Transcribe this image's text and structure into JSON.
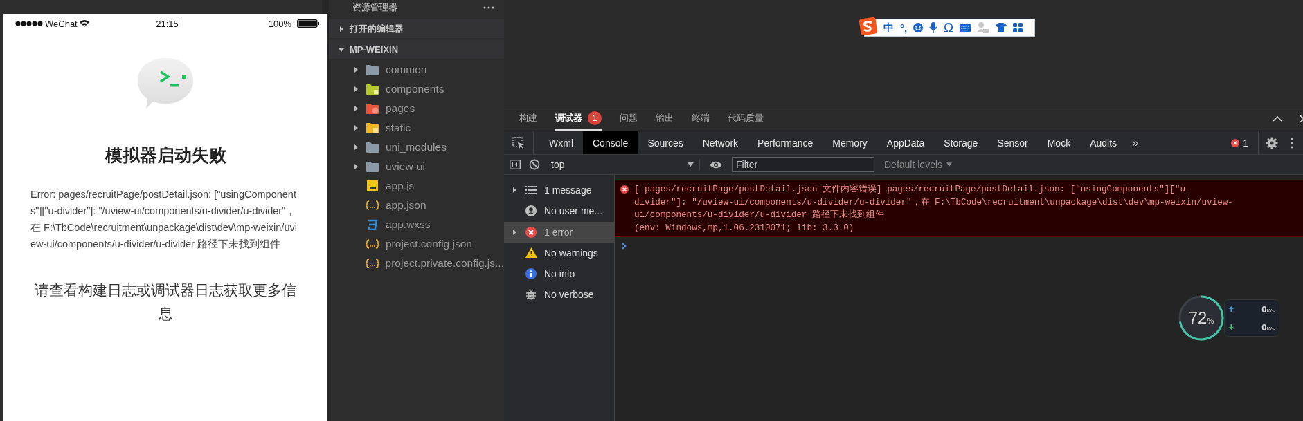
{
  "simulator": {
    "status_bar": {
      "carrier": "WeChat",
      "time": "21:15",
      "battery": "100%"
    },
    "title": "模拟器启动失败",
    "error": "Error: pages/recruitPage/postDetail.json: [\"usingComponents\"][\"u-divider\"]: \"/uview-ui/components/u-divider/u-divider\"，在 F:\\TbCode\\recruitment\\unpackage\\dist\\dev\\mp-weixin/uview-ui/components/u-divider/u-divider 路径下未找到组件",
    "hint": "请查看构建日志或调试器日志获取更多信息"
  },
  "explorer": {
    "title": "资源管理器",
    "sections": [
      {
        "label": "打开的编辑器",
        "expanded": false
      },
      {
        "label": "MP-WEIXIN",
        "expanded": true
      }
    ],
    "files": [
      {
        "name": "common",
        "kind": "folder"
      },
      {
        "name": "components",
        "kind": "components-folder"
      },
      {
        "name": "pages",
        "kind": "pages-folder"
      },
      {
        "name": "static",
        "kind": "static-folder"
      },
      {
        "name": "uni_modules",
        "kind": "folder"
      },
      {
        "name": "uview-ui",
        "kind": "folder"
      },
      {
        "name": "app.js",
        "kind": "js"
      },
      {
        "name": "app.json",
        "kind": "json"
      },
      {
        "name": "app.wxss",
        "kind": "css"
      },
      {
        "name": "project.config.json",
        "kind": "json"
      },
      {
        "name": "project.private.config.js...",
        "kind": "json"
      }
    ]
  },
  "ime_bar": {
    "mode": "中",
    "punctuation": "°,"
  },
  "devtools": {
    "panel_tabs": [
      {
        "label": "构建",
        "selected": false
      },
      {
        "label": "调试器",
        "selected": true,
        "badge": "1"
      },
      {
        "label": "问题",
        "selected": false
      },
      {
        "label": "输出",
        "selected": false
      },
      {
        "label": "终端",
        "selected": false
      },
      {
        "label": "代码质量",
        "selected": false
      }
    ],
    "tool_tabs": [
      {
        "label": "Wxml",
        "selected": false
      },
      {
        "label": "Console",
        "selected": true
      },
      {
        "label": "Sources",
        "selected": false
      },
      {
        "label": "Network",
        "selected": false
      },
      {
        "label": "Performance",
        "selected": false
      },
      {
        "label": "Memory",
        "selected": false
      },
      {
        "label": "AppData",
        "selected": false
      },
      {
        "label": "Storage",
        "selected": false
      },
      {
        "label": "Sensor",
        "selected": false
      },
      {
        "label": "Mock",
        "selected": false
      },
      {
        "label": "Audits",
        "selected": false
      }
    ],
    "more_tabs": "»",
    "error_count": "1",
    "console": {
      "context": "top",
      "filter_placeholder": "Filter",
      "levels": "Default levels",
      "sidebar": [
        {
          "label": "1 message",
          "kind": "message",
          "selected": false
        },
        {
          "label": "No user me...",
          "kind": "user",
          "selected": false
        },
        {
          "label": "1 error",
          "kind": "error",
          "selected": true
        },
        {
          "label": "No warnings",
          "kind": "warning",
          "selected": false
        },
        {
          "label": "No info",
          "kind": "info",
          "selected": false
        },
        {
          "label": "No verbose",
          "kind": "verbose",
          "selected": false
        }
      ],
      "messages": [
        {
          "kind": "error",
          "lines": [
            "[ pages/recruitPage/postDetail.json 文件内容错误] pages/recruitPage/postDetail.json: [\"usingComponents\"][\"u-",
            "divider\"]: \"/uview-ui/components/u-divider/u-divider\"，在 F:\\TbCode\\recruitment\\unpackage\\dist\\dev\\mp-weixin/uview-",
            "ui/components/u-divider/u-divider 路径下未找到组件",
            "(env: Windows,mp,1.06.2310071; lib: 3.3.0)"
          ]
        }
      ]
    }
  },
  "monitor": {
    "cpu": "72",
    "cpu_unit": "%",
    "upload": {
      "value": "0",
      "unit": "K/s"
    },
    "download": {
      "value": "0",
      "unit": "K/s"
    }
  }
}
